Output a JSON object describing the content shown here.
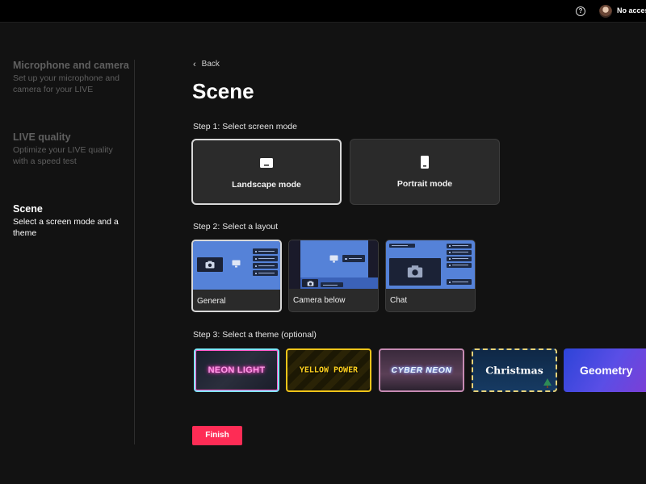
{
  "topbar": {
    "help_icon": "question-circle-icon",
    "account_label": "No access"
  },
  "sidebar": {
    "steps": [
      {
        "title": "Microphone and camera",
        "desc": "Set up your microphone and camera for your LIVE",
        "state": "inactive"
      },
      {
        "title": "LIVE quality",
        "desc": "Optimize your LIVE quality with a speed test",
        "state": "inactive"
      },
      {
        "title": "Scene",
        "desc": "Select a screen mode and a theme",
        "state": "active"
      }
    ]
  },
  "main": {
    "back_label": "Back",
    "title": "Scene",
    "step1_label": "Step 1: Select screen mode",
    "modes": [
      {
        "label": "Landscape mode",
        "icon": "landscape-screen-icon",
        "selected": true
      },
      {
        "label": "Portrait mode",
        "icon": "portrait-screen-icon",
        "selected": false
      }
    ],
    "step2_label": "Step 2: Select a layout",
    "layouts": [
      {
        "label": "General",
        "selected": true
      },
      {
        "label": "Camera below",
        "selected": false
      },
      {
        "label": "Chat",
        "selected": false
      }
    ],
    "step3_label": "Step 3: Select a theme (optional)",
    "themes": [
      {
        "label": "NEON LIGHT"
      },
      {
        "label": "YELLOW POWER"
      },
      {
        "label": "CYBER NEON"
      },
      {
        "label": "Christmas"
      },
      {
        "label": "Geometry"
      }
    ],
    "finish_label": "Finish"
  },
  "colors": {
    "accent": "#fe2c55",
    "background": "#121212",
    "card": "#2a2a2a",
    "preview_blue": "#5582d8"
  }
}
